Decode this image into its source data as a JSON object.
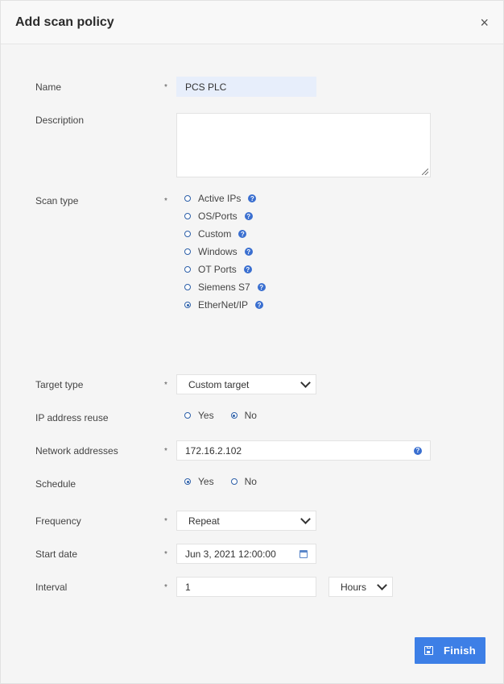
{
  "dialog": {
    "title": "Add scan policy",
    "close_icon": "×"
  },
  "labels": {
    "name": "Name",
    "description": "Description",
    "scan_type": "Scan type",
    "target_type": "Target type",
    "ip_reuse": "IP address reuse",
    "network_addresses": "Network addresses",
    "schedule": "Schedule",
    "frequency": "Frequency",
    "start_date": "Start date",
    "interval": "Interval"
  },
  "required_marker": "*",
  "name_value": "PCS PLC",
  "description_value": "",
  "scan_types": [
    {
      "label": "Active IPs",
      "checked": false
    },
    {
      "label": "OS/Ports",
      "checked": false
    },
    {
      "label": "Custom",
      "checked": false
    },
    {
      "label": "Windows",
      "checked": false
    },
    {
      "label": "OT Ports",
      "checked": false
    },
    {
      "label": "Siemens S7",
      "checked": false
    },
    {
      "label": "EtherNet/IP",
      "checked": true
    }
  ],
  "help_icon": "?",
  "target_type_value": "Custom target",
  "ip_reuse": {
    "yes": "Yes",
    "no": "No",
    "selected": "No"
  },
  "network_addresses_value": "172.16.2.102",
  "schedule": {
    "yes": "Yes",
    "no": "No",
    "selected": "Yes"
  },
  "frequency_value": "Repeat",
  "start_date_value": "Jun 3, 2021 12:00:00",
  "interval_value": "1",
  "interval_unit": "Hours",
  "finish_label": "Finish",
  "accent_color": "#3d7fe6"
}
